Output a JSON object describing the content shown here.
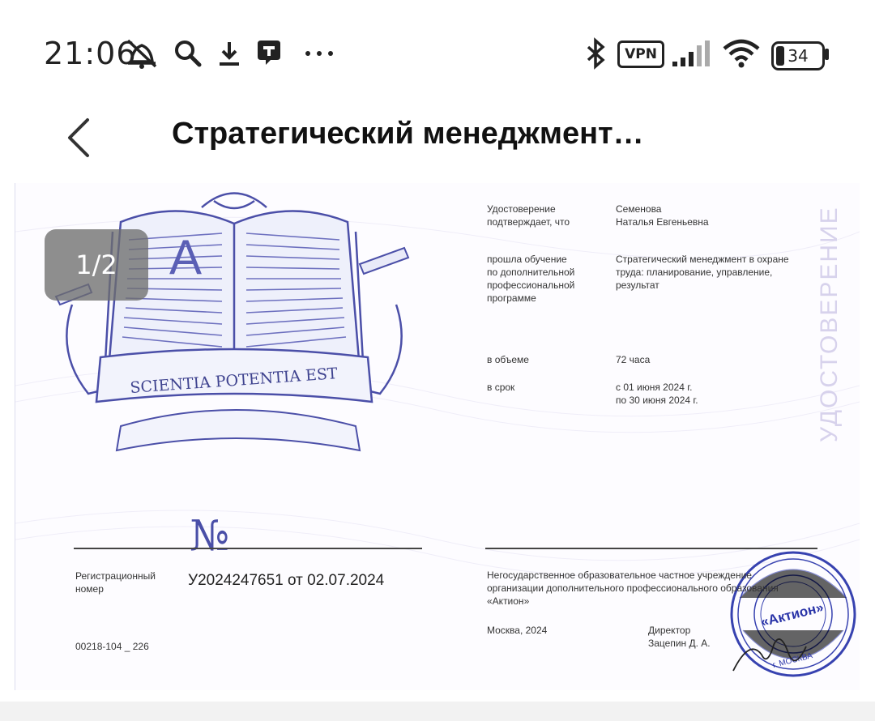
{
  "status_bar": {
    "time": "21:06",
    "vpn_label": "VPN",
    "battery_level": "34",
    "icons": [
      "alarm-off-icon",
      "search-icon",
      "download-icon",
      "chat-app-icon",
      "more-icon",
      "bluetooth-icon",
      "vpn-icon",
      "signal-icon",
      "wifi-icon",
      "battery-icon"
    ]
  },
  "header": {
    "title": "Стратегический менеджмент…",
    "back_icon": "chevron-left-icon"
  },
  "viewer": {
    "page_indicator": "1/2"
  },
  "certificate": {
    "emblem_motto": "SCIENTIA POTENTIA EST",
    "emblem_letter": "A",
    "number_sign": "№",
    "side_word": "УДОСТОВЕРЕНИЕ",
    "fields": [
      {
        "label": "Удостоверение\nподтверждает, что",
        "value": "Семенова\nНаталья Евгеньевна"
      },
      {
        "label": "прошла обучение\nпо дополнительной\nпрофессиональной\nпрограмме",
        "value": "Стратегический менеджмент в охране\nтруда: планирование, управление,\nрезультат"
      },
      {
        "label": "в объеме",
        "value": "72 часа"
      },
      {
        "label": "в срок",
        "value": "с 01 июня 2024 г.\nпо 30 июня 2024 г."
      }
    ],
    "registration_label": "Регистрационный\nномер",
    "registration_number": "У2024247651 от 02.07.2024",
    "form_code": "00218-104 _ 226",
    "organization": "Негосударственное образовательное частное учреждение\nорганизации дополнительного профессионального образования\n«Актион»",
    "city_year": "Москва, 2024",
    "signer_title": "Директор",
    "signer_name": "Зацепин Д. А.",
    "stamp_center": "«Актион»",
    "stamp_city": "г. МОСКВА"
  }
}
